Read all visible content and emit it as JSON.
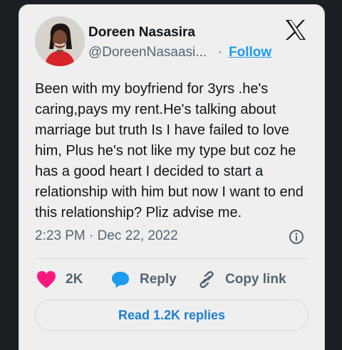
{
  "tweet": {
    "author": {
      "name": "Doreen Nasasira",
      "handle": "@DoreenNasaasi...",
      "separator": "·",
      "follow_label": "Follow"
    },
    "platform_icon": "x-logo-icon",
    "text": "Been with my boyfriend for 3yrs .he's caring,pays my rent.He's talking about marriage but truth Is I have failed to love him, Plus he's not like my type but coz he has a good heart I decided to start a relationship with him but now I want to end this relationship? Pliz advise me.",
    "timestamp": "2:23 PM · Dec 22, 2022",
    "actions": {
      "like_count": "2K",
      "reply_label": "Reply",
      "copy_label": "Copy link"
    },
    "read_replies_label": "Read 1.2K replies"
  },
  "colors": {
    "background": "#1b1f24",
    "card": "#efefef",
    "like": "#f91880",
    "accent": "#1d9bf0",
    "muted": "#536471"
  }
}
